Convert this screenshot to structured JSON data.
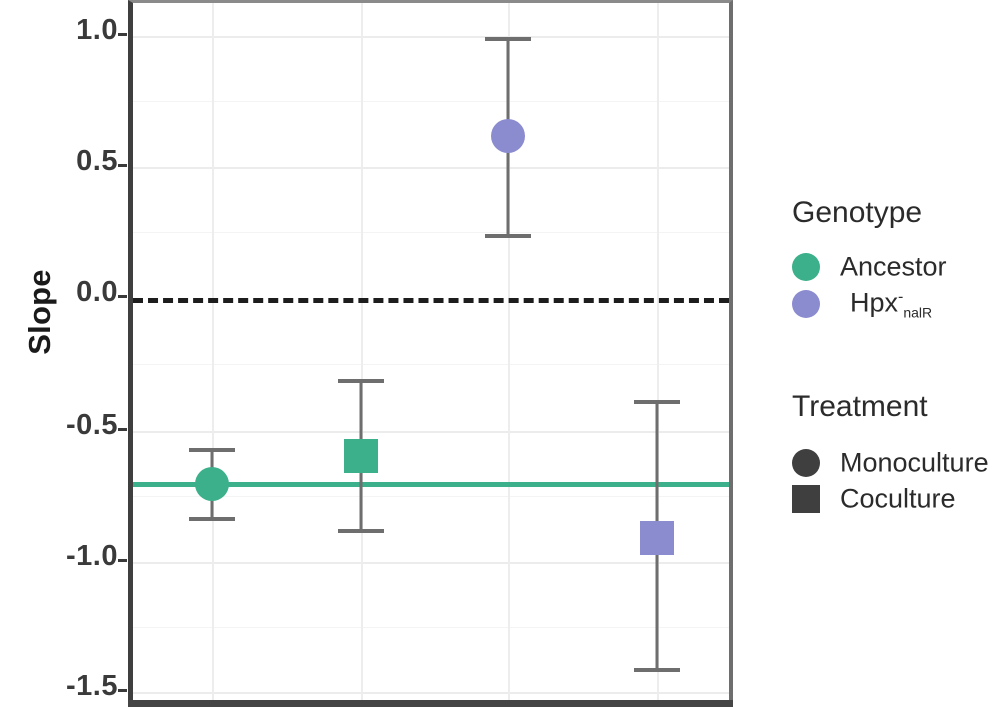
{
  "chart_data": {
    "type": "scatter",
    "title": "",
    "xlabel": "",
    "ylabel": "Slope",
    "ylim": [
      -1.58,
      1.13
    ],
    "yticks": [
      1.0,
      0.5,
      0.0,
      -0.5,
      -1.0,
      -1.5
    ],
    "ytick_labels": [
      "1.0",
      "0.5",
      "0.0",
      "-0.5",
      "-1.0",
      "-1.5"
    ],
    "grid": true,
    "legend_position": "right",
    "reference_lines": [
      {
        "name": "zero-line",
        "y": 0.0,
        "style": "dashed",
        "color": "#1d1d1d"
      },
      {
        "name": "ancestor-monoculture-reference",
        "y": -0.72,
        "style": "solid",
        "color": "#3bb08a"
      }
    ],
    "categories": [
      "Ancestor Monoculture",
      "Ancestor Coculture",
      "Hpx- nalR Monoculture",
      "Hpx- nalR Coculture"
    ],
    "points": [
      {
        "label": "Ancestor Monoculture",
        "genotype": "Ancestor",
        "treatment": "Monoculture",
        "marker": "circle",
        "color": "#3bb08a",
        "x": 1,
        "y": -0.72,
        "ymin": -0.85,
        "ymax": -0.6
      },
      {
        "label": "Ancestor Coculture",
        "genotype": "Ancestor",
        "treatment": "Coculture",
        "marker": "square",
        "color": "#3bb08a",
        "x": 2,
        "y": -0.61,
        "ymin": -0.9,
        "ymax": -0.32
      },
      {
        "label": "Hpx- nalR Monoculture",
        "genotype": "Hpx- nalR",
        "treatment": "Monoculture",
        "marker": "circle",
        "color": "#8b8bd0",
        "x": 3,
        "y": 0.62,
        "ymin": 0.24,
        "ymax": 1.01
      },
      {
        "label": "Hpx- nalR Coculture",
        "genotype": "Hpx- nalR",
        "treatment": "Coculture",
        "marker": "square",
        "color": "#8b8bd0",
        "x": 4,
        "y": -0.93,
        "ymin": -1.46,
        "ymax": -0.39
      }
    ]
  },
  "axis": {
    "y_title": "Slope",
    "tick_labels": [
      "1.0",
      "0.5",
      "0.0",
      "-0.5",
      "-1.0",
      "-1.5"
    ]
  },
  "legend": {
    "genotype": {
      "title": "Genotype",
      "items": [
        {
          "label": "Ancestor",
          "color": "#3bb08a",
          "marker": "circle",
          "sup": "",
          "sub": ""
        },
        {
          "label": "Hpx",
          "color": "#8b8bd0",
          "marker": "circle",
          "sup": "-",
          "sub": "nalR"
        }
      ]
    },
    "treatment": {
      "title": "Treatment",
      "items": [
        {
          "label": "Monoculture",
          "color": "#3f3f3f",
          "marker": "circle"
        },
        {
          "label": "Coculture",
          "color": "#3f3f3f",
          "marker": "square"
        }
      ]
    }
  },
  "colors": {
    "ancestor": "#3bb08a",
    "hpx": "#8b8bd0",
    "errorbar": "#6e6e6e",
    "zero_line": "#1d1d1d",
    "grid_major": "#ececec",
    "panel_border": "#3f3f3f"
  }
}
